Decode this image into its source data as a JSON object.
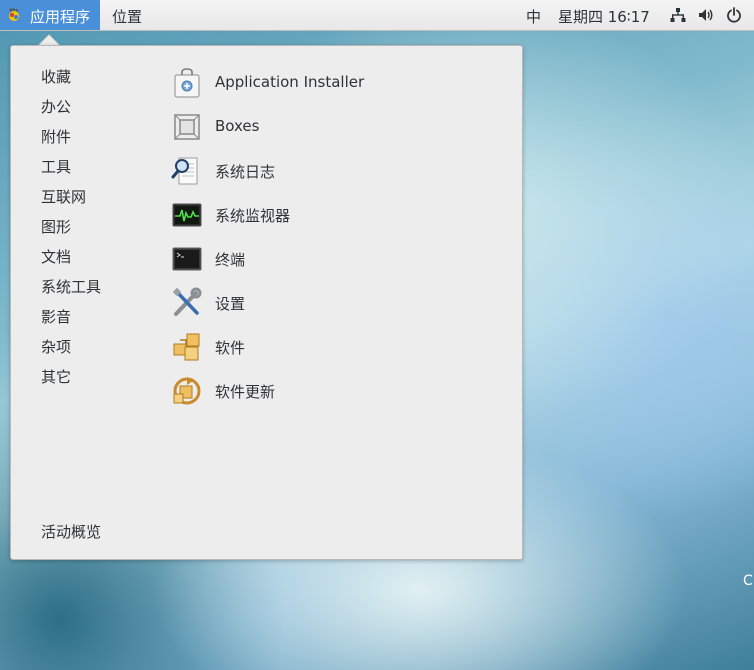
{
  "topbar": {
    "apps_label": "应用程序",
    "places_label": "位置",
    "ime": "中",
    "clock": "星期四 16∶17",
    "icons": [
      "network-icon",
      "volume-icon",
      "power-icon"
    ]
  },
  "popup": {
    "categories": [
      "收藏",
      "办公",
      "附件",
      "工具",
      "互联网",
      "图形",
      "文档",
      "系统工具",
      "影音",
      "杂项",
      "其它"
    ],
    "apps": [
      {
        "label": "Application Installer",
        "icon": "application-installer-icon"
      },
      {
        "label": "Boxes",
        "icon": "boxes-icon"
      },
      {
        "label": "系统日志",
        "icon": "system-log-icon"
      },
      {
        "label": "系统监视器",
        "icon": "system-monitor-icon"
      },
      {
        "label": "终端",
        "icon": "terminal-icon"
      },
      {
        "label": "设置",
        "icon": "settings-icon"
      },
      {
        "label": "软件",
        "icon": "software-icon"
      },
      {
        "label": "软件更新",
        "icon": "software-update-icon"
      }
    ],
    "overview_label": "活动概览"
  },
  "desktop": {
    "edge_text": "C"
  },
  "colors": {
    "accent": "#4a90d9",
    "panel_bg": "#ededed"
  }
}
